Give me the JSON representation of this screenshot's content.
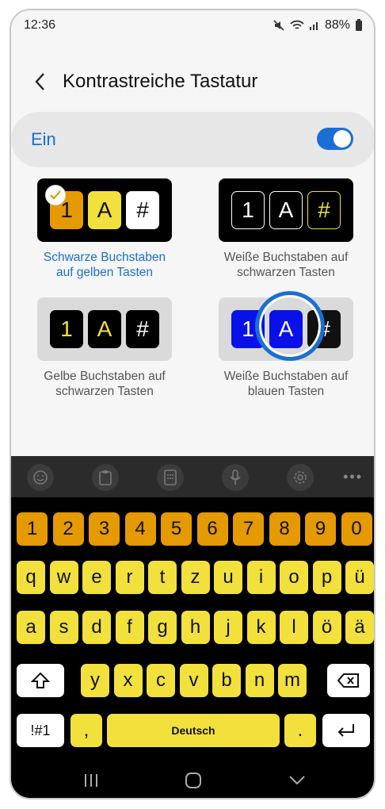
{
  "status": {
    "time": "12:36",
    "battery": "88%"
  },
  "header": {
    "title": "Kontrastreiche Tastatur"
  },
  "toggle": {
    "label": "Ein",
    "state": "on"
  },
  "options": [
    {
      "keys": [
        "1",
        "A",
        "#"
      ],
      "caption_line1": "Schwarze Buchstaben",
      "caption_line2": "auf gelben Tasten",
      "selected": true
    },
    {
      "keys": [
        "1",
        "A",
        "#"
      ],
      "caption_line1": "Weiße Buchstaben auf",
      "caption_line2": "schwarzen Tasten",
      "selected": false
    },
    {
      "keys": [
        "1",
        "A",
        "#"
      ],
      "caption_line1": "Gelbe Buchstaben auf",
      "caption_line2": "schwarzen Tasten",
      "selected": false
    },
    {
      "keys": [
        "1",
        "A",
        "#"
      ],
      "caption_line1": "Weiße Buchstaben auf",
      "caption_line2": "blauen Tasten",
      "selected": false
    }
  ],
  "keyboard": {
    "toolbar_icons": [
      "emoji-icon",
      "clipboard-icon",
      "keypad-icon",
      "mic-icon",
      "settings-icon",
      "more-icon"
    ],
    "row_numbers": [
      "1",
      "2",
      "3",
      "4",
      "5",
      "6",
      "7",
      "8",
      "9",
      "0"
    ],
    "row1": [
      "q",
      "w",
      "e",
      "r",
      "t",
      "z",
      "u",
      "i",
      "o",
      "p",
      "ü"
    ],
    "row2": [
      "a",
      "s",
      "d",
      "f",
      "g",
      "h",
      "j",
      "k",
      "l",
      "ö",
      "ä"
    ],
    "row3": [
      "y",
      "x",
      "c",
      "v",
      "b",
      "n",
      "m"
    ],
    "symbols": "!#1",
    "comma": ",",
    "space": "Deutsch",
    "period": "."
  },
  "colors": {
    "accent": "#1a6fd4",
    "key_yellow": "#f2e03c",
    "key_orange": "#e49a00",
    "key_blue": "#0a10e8"
  }
}
